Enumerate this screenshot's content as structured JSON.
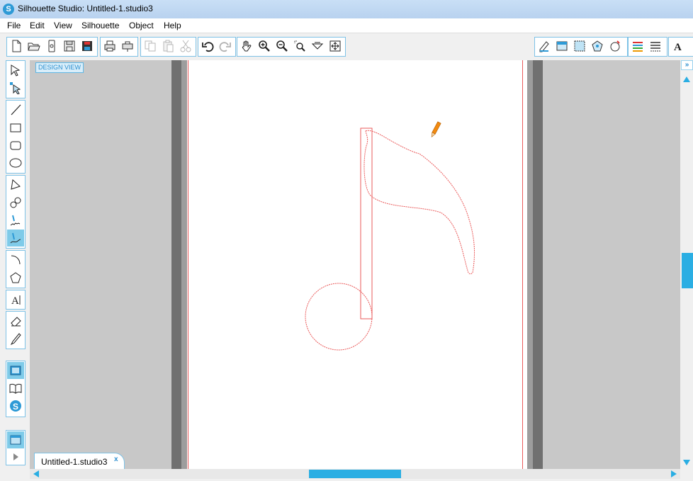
{
  "window": {
    "title": "Silhouette Studio: Untitled-1.studio3",
    "app_icon_glyph": "S"
  },
  "menu": [
    "File",
    "Edit",
    "View",
    "Silhouette",
    "Object",
    "Help"
  ],
  "toolbar": {
    "file_group": [
      "new-document-icon",
      "open-folder-icon",
      "open-library-icon",
      "save-icon",
      "save-to-library-icon"
    ],
    "print_group": [
      "print-icon",
      "send-to-silhouette-icon"
    ],
    "clipboard_group": [
      "copy-icon",
      "paste-icon",
      "cut-icon"
    ],
    "history_group": [
      "undo-icon",
      "redo-icon"
    ],
    "view_group": [
      "pan-hand-icon",
      "zoom-in-icon",
      "zoom-out-icon",
      "zoom-select-icon",
      "drag-zoom-icon",
      "fit-to-page-icon"
    ],
    "right_group": [
      "page-settings-icon",
      "cut-settings-icon",
      "registration-icon",
      "trace-icon",
      "fill-icon",
      "line-color-icon",
      "line-style-icon",
      "text-style-icon"
    ]
  },
  "tools": {
    "select": [
      "select-arrow-icon",
      "point-edit-icon"
    ],
    "shapes": [
      "line-tool-icon",
      "rectangle-tool-icon",
      "rounded-rectangle-tool-icon",
      "ellipse-tool-icon"
    ],
    "polygons": [
      "polygon-tool-icon",
      "curve-tool-icon",
      "freehand-tool-icon",
      "smooth-freehand-tool-icon"
    ],
    "arcs": [
      "arc-tool-icon",
      "regular-polygon-tool-icon"
    ],
    "text": [
      "text-tool-icon"
    ],
    "erase": [
      "eraser-tool-icon",
      "knife-tool-icon"
    ],
    "views": [
      "design-view-icon",
      "library-view-icon",
      "silhouette-store-icon"
    ],
    "bottom": [
      "show-panel-icon",
      "expand-icon"
    ]
  },
  "canvas": {
    "design_view_label": "DESIGN VIEW",
    "cut_line_color": "#ea5a5a",
    "accent": "#2aaee3"
  },
  "tab": {
    "name": "Untitled-1.studio3",
    "close": "x"
  }
}
